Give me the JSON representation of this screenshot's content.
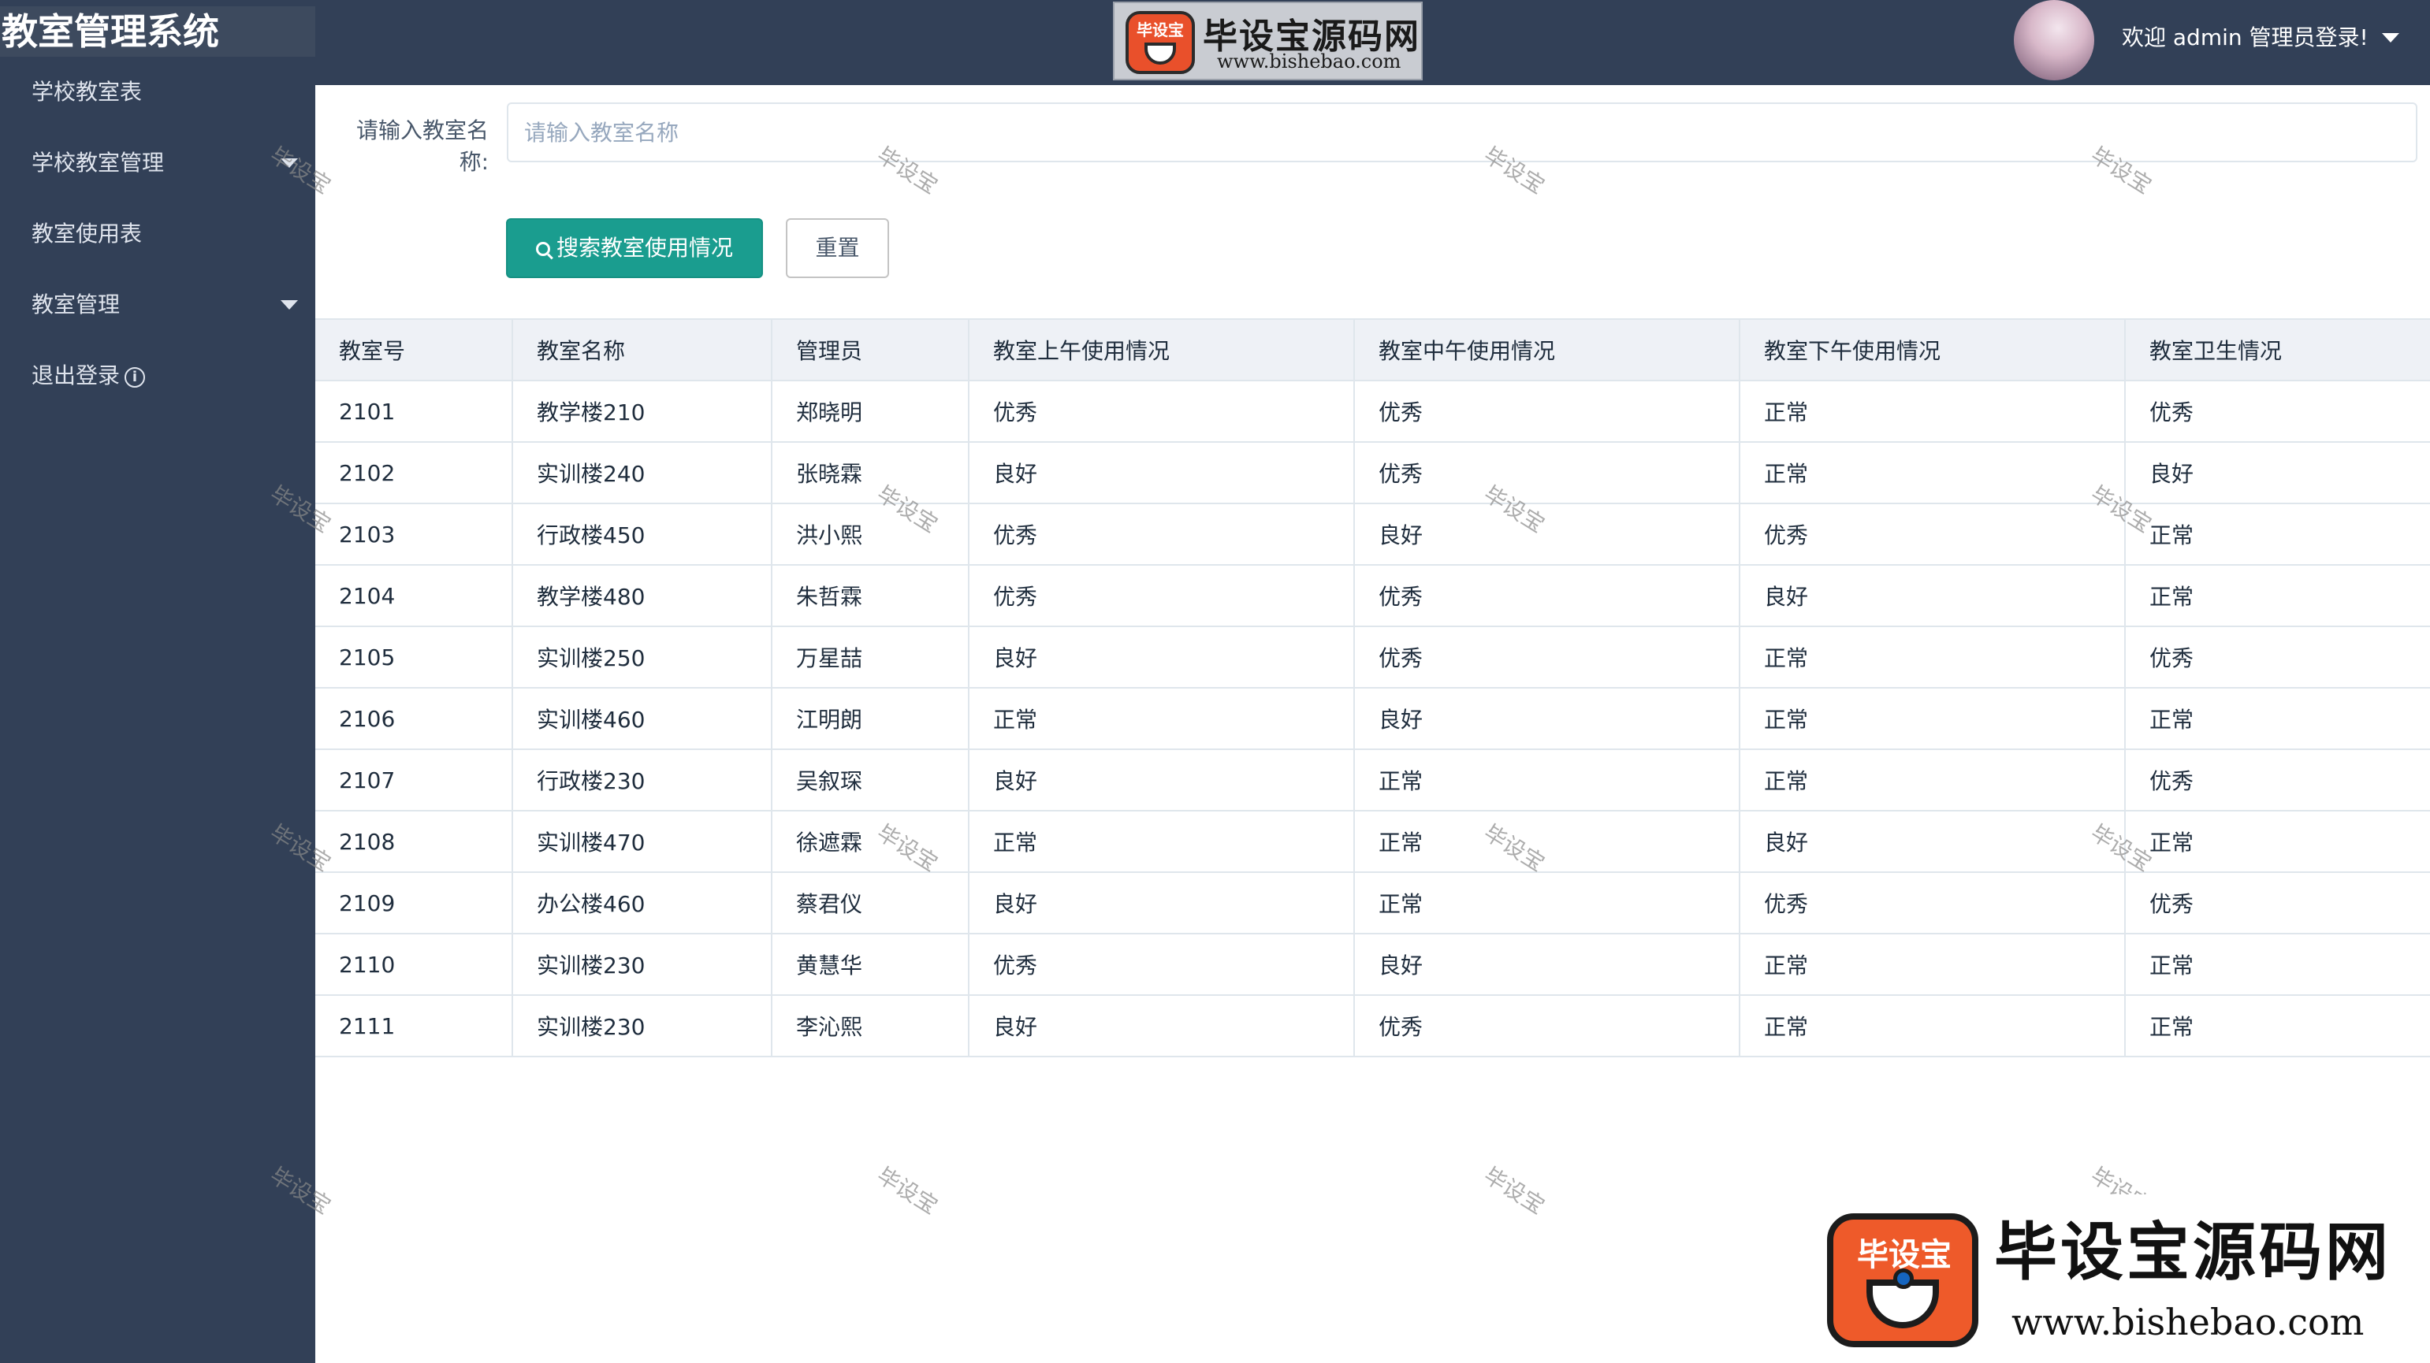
{
  "app": {
    "title": "教室管理系统",
    "welcome": "欢迎 admin 管理员登录!",
    "logo_name": "毕设宝源码网",
    "logo_url": "www.bishebao.com",
    "logo_badge": "毕设宝"
  },
  "sidebar": {
    "items": [
      {
        "label": "学校教室表"
      },
      {
        "label": "学校教室管理"
      },
      {
        "label": "教室使用表"
      },
      {
        "label": "教室管理"
      },
      {
        "label": "退出登录"
      }
    ]
  },
  "search": {
    "label": "请输入教室名称:",
    "placeholder": "请输入教室名称",
    "value": "",
    "search_button": "搜索教室使用情况",
    "reset_button": "重置"
  },
  "table": {
    "columns": [
      "教室号",
      "教室名称",
      "管理员",
      "教室上午使用情况",
      "教室中午使用情况",
      "教室下午使用情况",
      "教室卫生情况"
    ],
    "rows": [
      [
        "2101",
        "教学楼210",
        "郑晓明",
        "优秀",
        "优秀",
        "正常",
        "优秀"
      ],
      [
        "2102",
        "实训楼240",
        "张晓霖",
        "良好",
        "优秀",
        "正常",
        "良好"
      ],
      [
        "2103",
        "行政楼450",
        "洪小熙",
        "优秀",
        "良好",
        "优秀",
        "正常"
      ],
      [
        "2104",
        "教学楼480",
        "朱哲霖",
        "优秀",
        "优秀",
        "良好",
        "正常"
      ],
      [
        "2105",
        "实训楼250",
        "万星喆",
        "良好",
        "优秀",
        "正常",
        "优秀"
      ],
      [
        "2106",
        "实训楼460",
        "江明朗",
        "正常",
        "良好",
        "正常",
        "正常"
      ],
      [
        "2107",
        "行政楼230",
        "吴叙琛",
        "良好",
        "正常",
        "正常",
        "优秀"
      ],
      [
        "2108",
        "实训楼470",
        "徐遮霖",
        "正常",
        "正常",
        "良好",
        "正常"
      ],
      [
        "2109",
        "办公楼460",
        "蔡君仪",
        "良好",
        "正常",
        "优秀",
        "优秀"
      ],
      [
        "2110",
        "实训楼230",
        "黄慧华",
        "优秀",
        "良好",
        "正常",
        "正常"
      ],
      [
        "2111",
        "实训楼230",
        "李沁熙",
        "良好",
        "优秀",
        "正常",
        "正常"
      ]
    ]
  },
  "watermark": "毕设宝",
  "colors": {
    "sidebar_bg": "#324057",
    "primary_button": "#1a9d8f",
    "header_row_bg": "#eef1f6"
  }
}
